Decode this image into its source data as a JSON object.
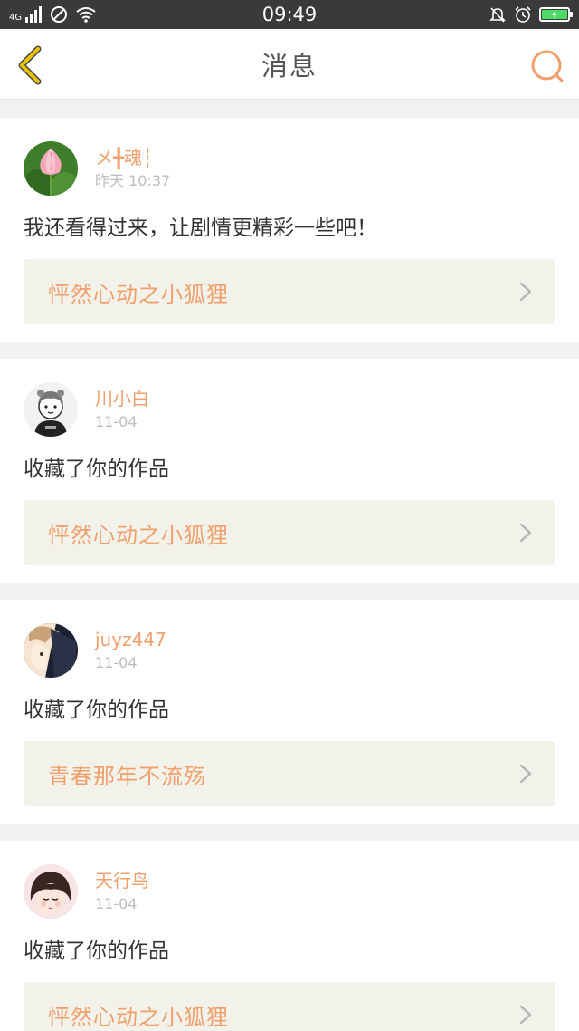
{
  "status_bar": {
    "network": "4G",
    "time": "09:49"
  },
  "nav": {
    "title": "消息"
  },
  "colors": {
    "accent": "#f0a06c",
    "back_icon": "#e8b400",
    "card_link_bg": "#f2f2ea"
  },
  "messages": [
    {
      "username": "メ╋魂┆",
      "time": "昨天 10:37",
      "text": "我还看得过来，让剧情更精彩一些吧！",
      "work_title": "怦然心动之小狐狸",
      "avatar_icon": "lotus-avatar-icon"
    },
    {
      "username": "川小白",
      "time": "11-04",
      "text": "收藏了你的作品",
      "work_title": "怦然心动之小狐狸",
      "avatar_icon": "cartoon-boy-avatar-icon"
    },
    {
      "username": "juyz447",
      "time": "11-04",
      "text": "收藏了你的作品",
      "work_title": "青春那年不流殇",
      "avatar_icon": "anime-boy-avatar-icon"
    },
    {
      "username": "天行鸟",
      "time": "11-04",
      "text": "收藏了你的作品",
      "work_title": "怦然心动之小狐狸",
      "avatar_icon": "anime-girl-avatar-icon"
    }
  ]
}
